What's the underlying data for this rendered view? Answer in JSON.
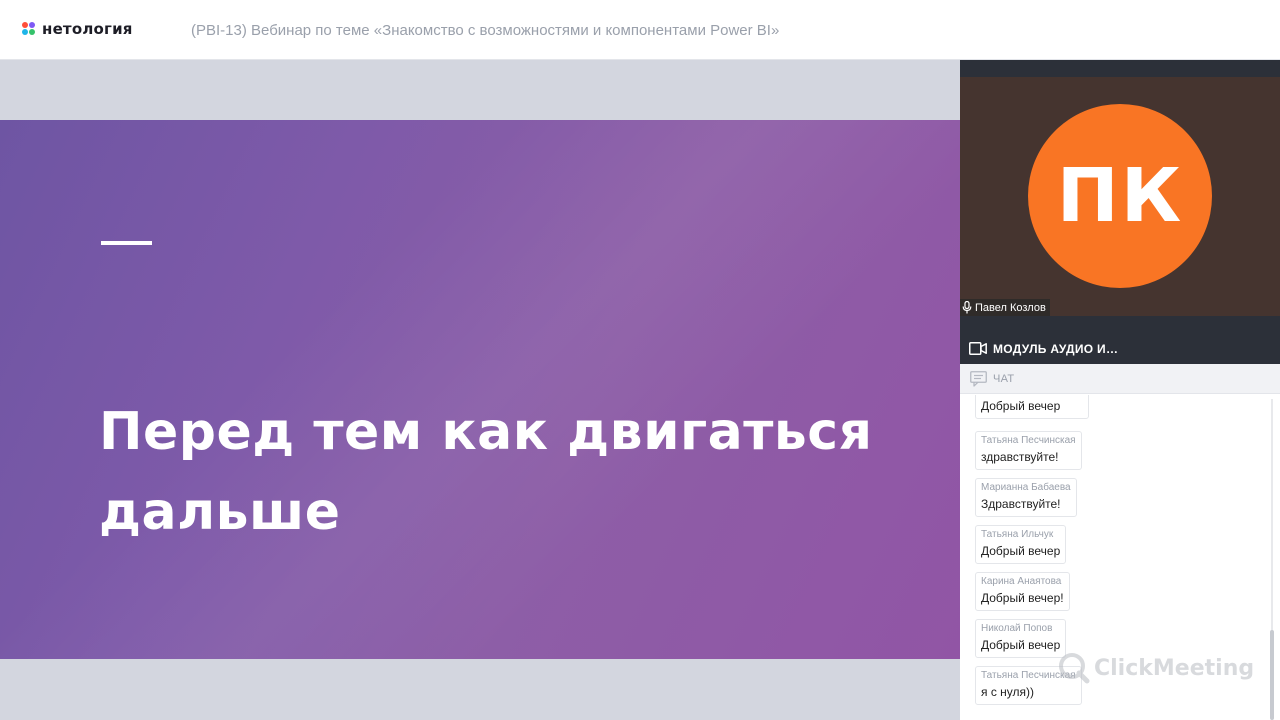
{
  "header": {
    "logo_text": "нетология",
    "webinar_title": "(PBI-13) Вебинар по теме «Знакомство с возможностями и компонентами Power BI»"
  },
  "slide": {
    "heading_line1": "Перед тем как двигаться",
    "heading_line2": "дальше"
  },
  "video": {
    "initials": "ПК",
    "presenter_name": "Павел Козлов"
  },
  "panels": {
    "module_label": "МОДУЛЬ АУДИО И…",
    "chat_label": "ЧАТ"
  },
  "chat": {
    "messages": [
      {
        "author": "",
        "text": "Добрый вечер"
      },
      {
        "author": "Татьяна Песчинская",
        "text": "здравствуйте!"
      },
      {
        "author": "Марианна Бабаева",
        "text": "Здравствуйте!"
      },
      {
        "author": "Татьяна Ильчук",
        "text": "Добрый вечер"
      },
      {
        "author": "Карина Анаятова",
        "text": "Добрый вечер!"
      },
      {
        "author": "Николай Попов",
        "text": "Добрый вечер"
      },
      {
        "author": "Татьяна Песчинская",
        "text": "я с нуля))"
      }
    ]
  },
  "watermark": {
    "text": "ClickMeeting"
  },
  "colors": {
    "avatar": "#f97524",
    "slide_gradient_start": "#6e55a3",
    "slide_gradient_end": "#9155a5",
    "panel_dark": "#2c3039",
    "video_bg": "#45342f"
  },
  "icons": {
    "logo": "logo-dots-icon",
    "mic": "microphone-icon",
    "module": "video-camera-icon",
    "chat": "chat-bubble-icon",
    "watermark": "clickmeeting-logo-icon"
  }
}
